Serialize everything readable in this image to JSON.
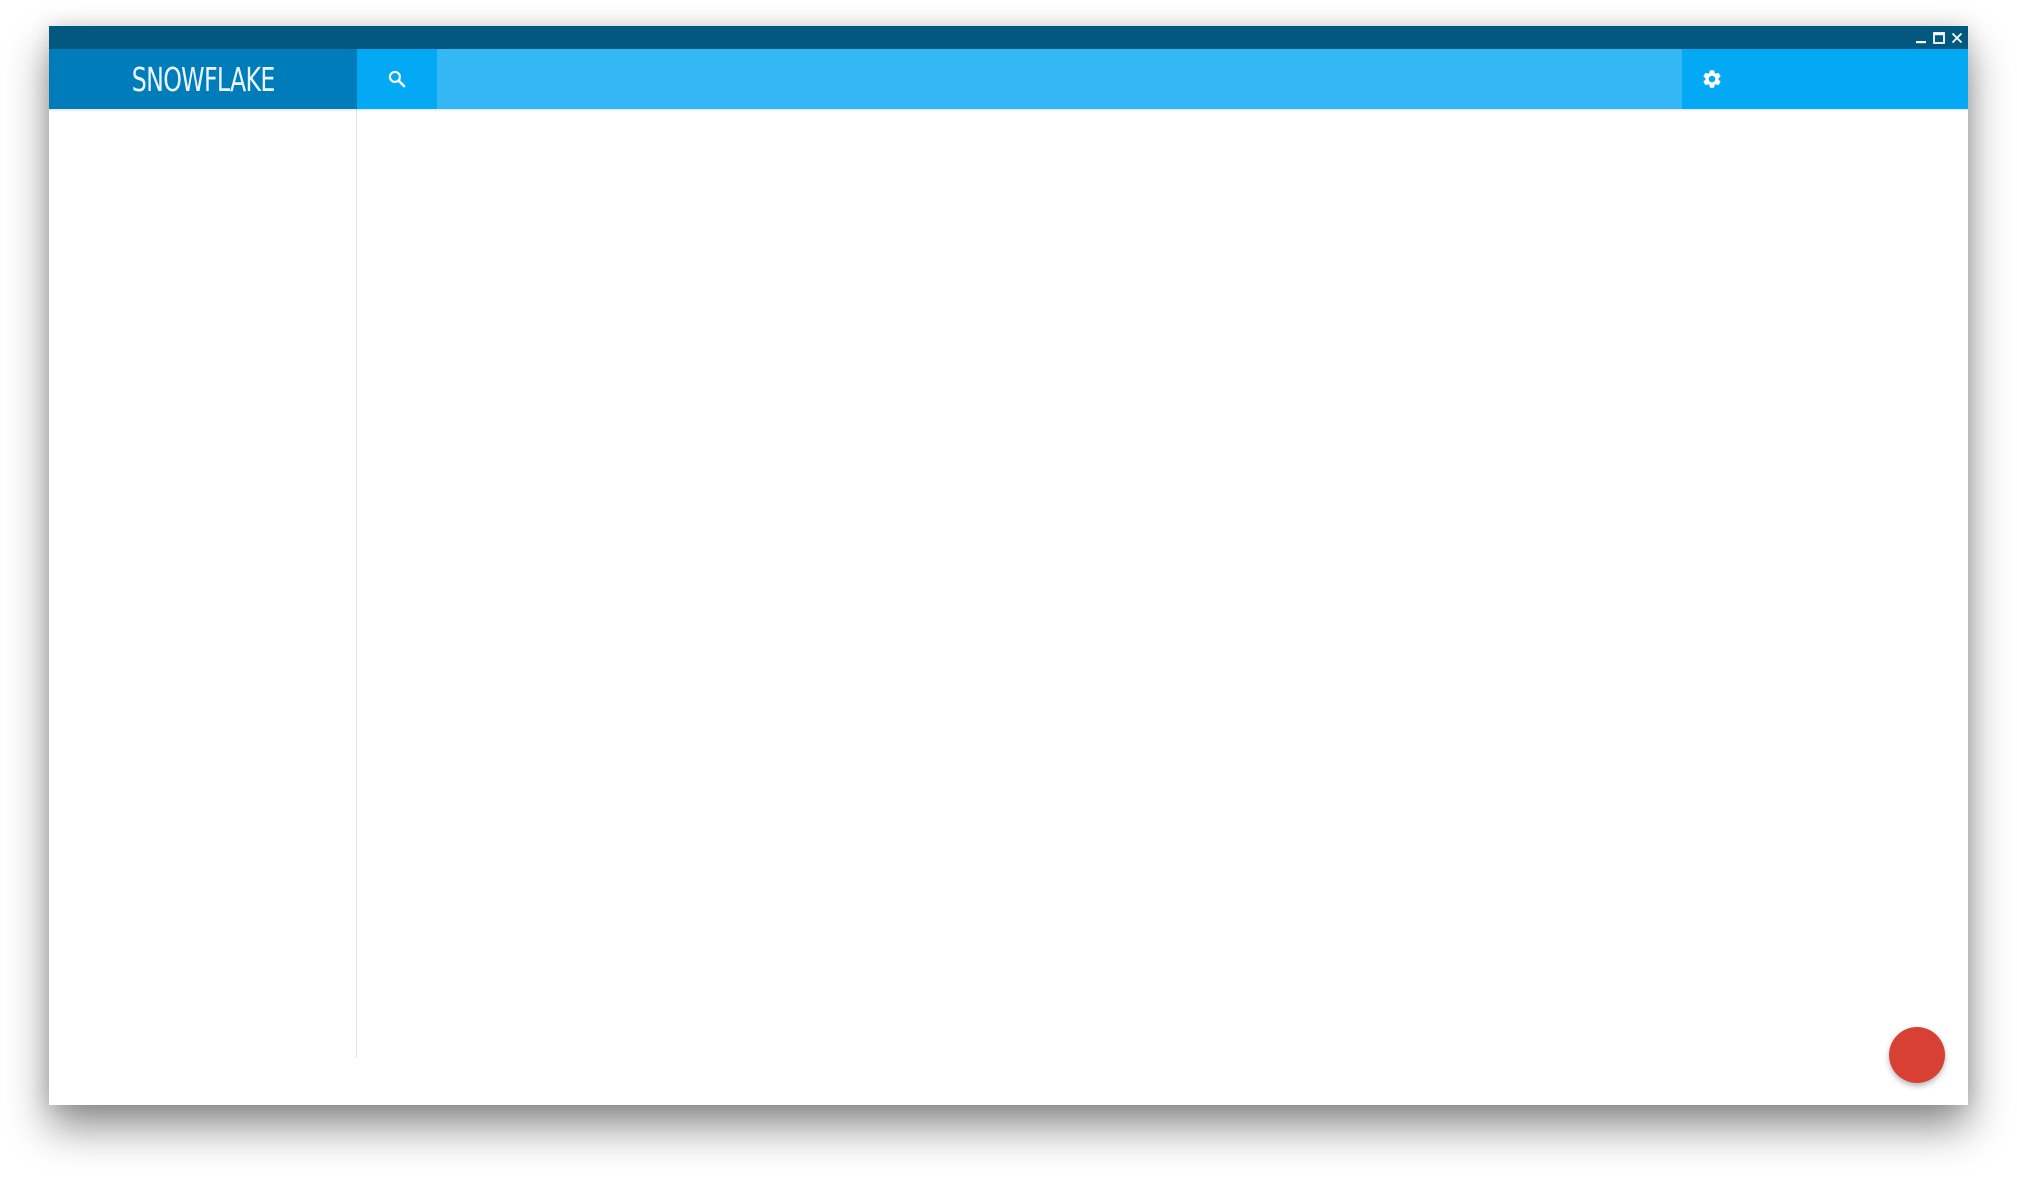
{
  "app": {
    "brand": "SNOWFLAKE"
  },
  "window_controls": {
    "minimize_icon": "minimize-icon",
    "maximize_icon": "maximize-icon",
    "close_icon": "close-icon"
  },
  "toolbar": {
    "search_icon": "search-icon",
    "search_value": "",
    "settings_icon": "gear-icon"
  },
  "fab": {
    "label": ""
  },
  "colors": {
    "titlebar": "#02587f",
    "brand_bg": "#017cba",
    "primary": "#03a9f4",
    "search_bg": "#33b8f5",
    "fab": "#d84033"
  }
}
